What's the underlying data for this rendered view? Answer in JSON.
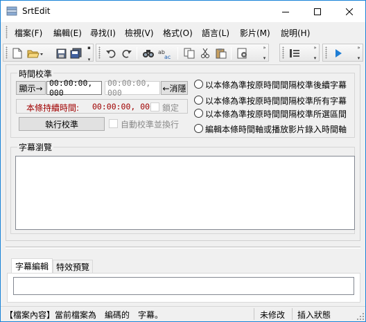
{
  "window": {
    "title": "SrtEdit"
  },
  "menu": {
    "items": [
      "檔案(F)",
      "編輯(E)",
      "尋找(I)",
      "檢視(V)",
      "格式(O)",
      "語言(L)",
      "影片(M)",
      "說明(H)"
    ]
  },
  "timing": {
    "group_title": "時間校準",
    "show_button": "顯示→",
    "time_value": "00:00:00, 000",
    "time_value_disabled": "00:00:00, 000",
    "hide_button": "←消隱",
    "duration_label": "本條持續時間:",
    "duration_value": "00:00:00, 000",
    "lock_label": "鎖定",
    "execute_button": "執行校準",
    "auto_label": "自動校準並換行",
    "options": [
      "以本條為準按原時間間隔校準後續字幕",
      "以本條為準按原時間間隔校準所有字幕",
      "以本條為準按原時間間隔校準所選區間",
      "編輯本條時間軸或播放影片錄入時間軸"
    ]
  },
  "browse": {
    "group_title": "字幕瀏覽"
  },
  "tabs": [
    "字幕編輯",
    "特效預覽"
  ],
  "status": {
    "info": "【檔案內容】當前檔案為　編碼的　字幕。",
    "modified": "未修改",
    "mode": "插入狀態"
  },
  "colors": {
    "duration_red": "#a00000",
    "accent_blue": "#1e7dd4"
  }
}
